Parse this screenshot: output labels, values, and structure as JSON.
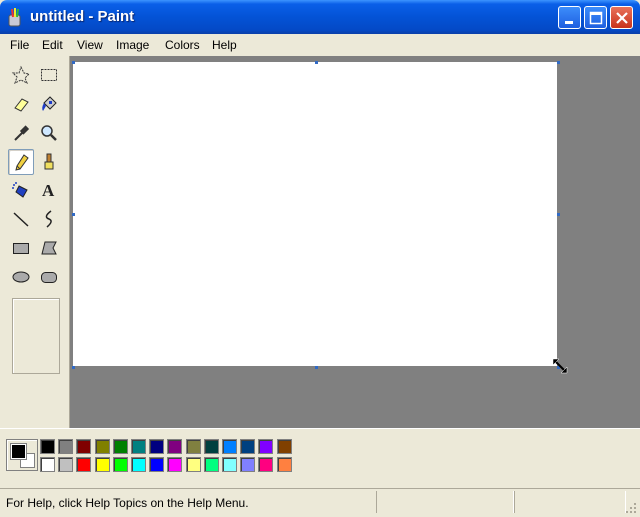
{
  "window": {
    "title": "untitled - Paint",
    "icon": "paint-app-icon",
    "controls": [
      {
        "name": "minimize-button",
        "icon": "minimize-icon"
      },
      {
        "name": "maximize-button",
        "icon": "maximize-icon"
      },
      {
        "name": "close-button",
        "icon": "close-icon"
      }
    ]
  },
  "menu": {
    "items": [
      "File",
      "Edit",
      "View",
      "Image",
      "Colors",
      "Help"
    ]
  },
  "toolbox": {
    "tools": [
      {
        "name": "free-form-select-tool",
        "icon": "free-form-select-icon"
      },
      {
        "name": "rectangle-select-tool",
        "icon": "rectangle-select-icon"
      },
      {
        "name": "eraser-tool",
        "icon": "eraser-icon"
      },
      {
        "name": "fill-with-color-tool",
        "icon": "paint-bucket-icon"
      },
      {
        "name": "pick-color-tool",
        "icon": "eyedropper-icon"
      },
      {
        "name": "magnifier-tool",
        "icon": "magnifier-icon"
      },
      {
        "name": "pencil-tool",
        "icon": "pencil-icon",
        "selected": true
      },
      {
        "name": "brush-tool",
        "icon": "brush-icon"
      },
      {
        "name": "airbrush-tool",
        "icon": "airbrush-icon"
      },
      {
        "name": "text-tool",
        "icon": "text-icon",
        "label": "A"
      },
      {
        "name": "line-tool",
        "icon": "line-icon"
      },
      {
        "name": "curve-tool",
        "icon": "curve-icon"
      },
      {
        "name": "rectangle-tool",
        "icon": "rectangle-icon"
      },
      {
        "name": "polygon-tool",
        "icon": "polygon-icon"
      },
      {
        "name": "ellipse-tool",
        "icon": "ellipse-icon"
      },
      {
        "name": "rounded-rectangle-tool",
        "icon": "rounded-rectangle-icon"
      }
    ]
  },
  "palette": {
    "foreground": "#000000",
    "background": "#ffffff",
    "top_row": [
      "#000000",
      "#808080",
      "#800000",
      "#808000",
      "#008000",
      "#008080",
      "#000080",
      "#800080",
      "#808040",
      "#004040",
      "#0080ff",
      "#004080",
      "#8000ff",
      "#804000"
    ],
    "bottom_row": [
      "#ffffff",
      "#c0c0c0",
      "#ff0000",
      "#ffff00",
      "#00ff00",
      "#00ffff",
      "#0000ff",
      "#ff00ff",
      "#ffff80",
      "#00ff80",
      "#80ffff",
      "#8080ff",
      "#ff0080",
      "#ff8040"
    ]
  },
  "status": {
    "help_text": "For Help, click Help Topics on the Help Menu."
  }
}
